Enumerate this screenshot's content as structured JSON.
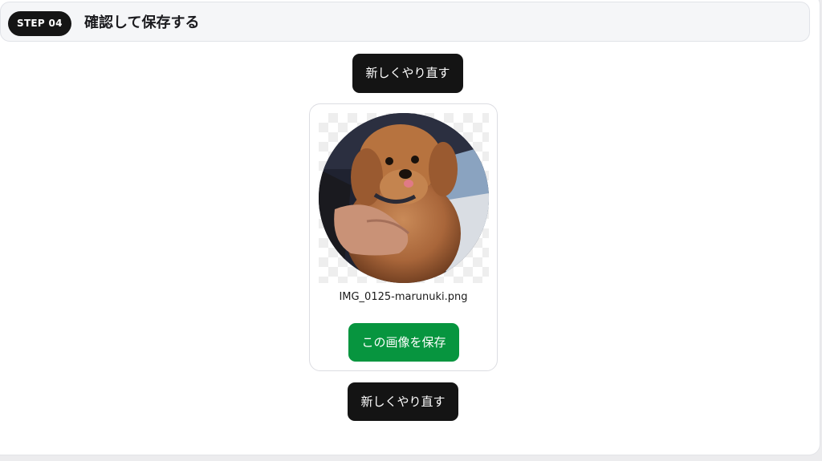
{
  "step": {
    "badge": "STEP 04",
    "title": "確認して保存する"
  },
  "actions": {
    "restart_top": "新しくやり直す",
    "restart_bottom": "新しくやり直す"
  },
  "result": {
    "filename": "IMG_0125-marunuki.png",
    "save_label": "この画像を保存"
  },
  "colors": {
    "dark_button": "#141414",
    "save_button": "#07953f",
    "header_bg": "#f5f6f8"
  }
}
